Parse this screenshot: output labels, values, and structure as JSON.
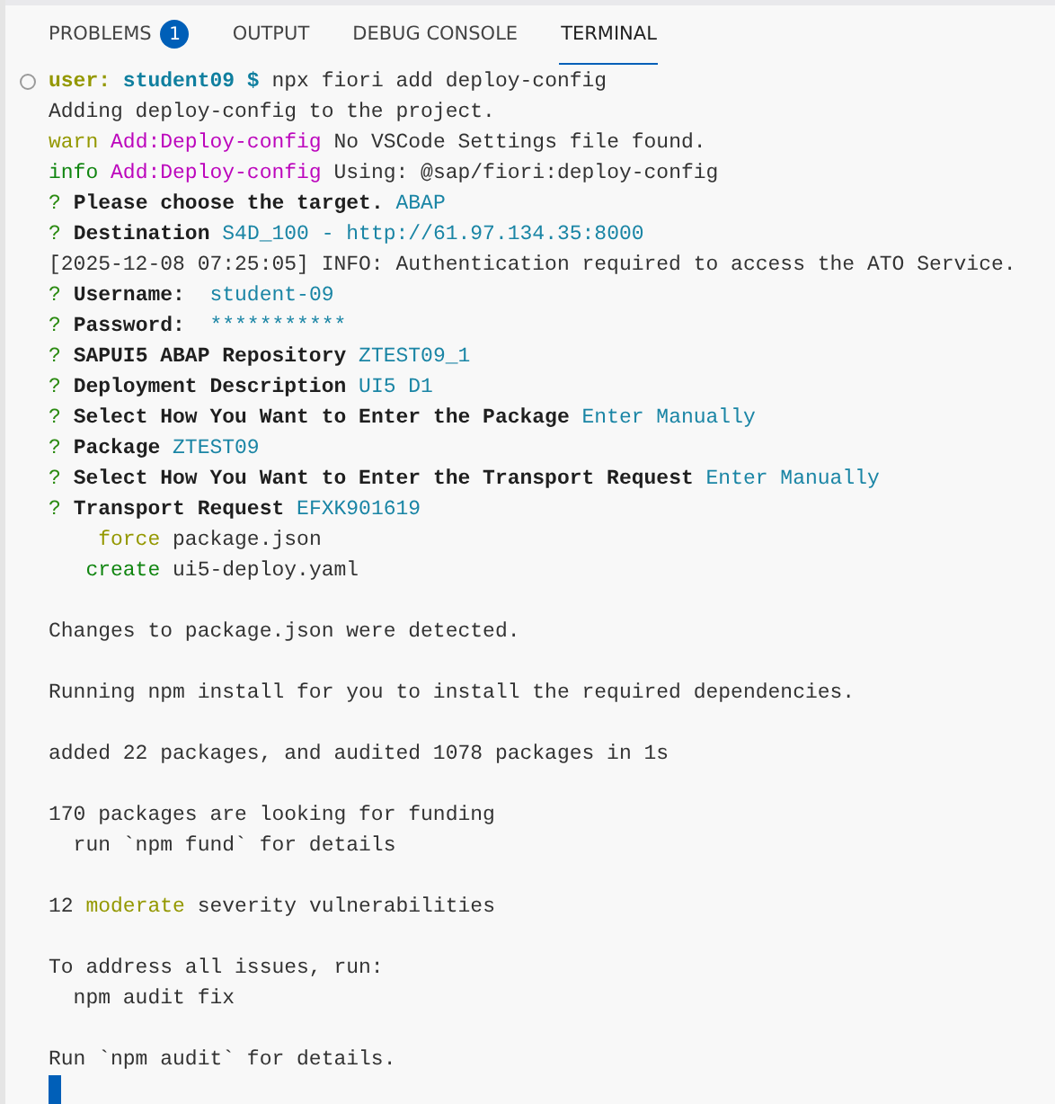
{
  "tabs": [
    {
      "label": "PROBLEMS",
      "badge": "1",
      "selected": false
    },
    {
      "label": "OUTPUT",
      "selected": false
    },
    {
      "label": "DEBUG CONSOLE",
      "selected": false
    },
    {
      "label": "TERMINAL",
      "selected": true
    }
  ],
  "terminal": {
    "lines": [
      {
        "kind": "prompt",
        "segments": [
          {
            "kind": "user",
            "text": "user: "
          },
          {
            "kind": "host",
            "text": "student09 $"
          },
          {
            "kind": "plain",
            "text": " npx fiori add deploy-config"
          }
        ]
      },
      {
        "kind": "output",
        "segments": [
          {
            "kind": "plain",
            "text": "Adding deploy-config to the project."
          }
        ]
      },
      {
        "kind": "output",
        "segments": [
          {
            "kind": "warn",
            "text": "warn "
          },
          {
            "kind": "tag",
            "text": "Add:Deploy-config"
          },
          {
            "kind": "plain",
            "text": " No VSCode Settings file found."
          }
        ]
      },
      {
        "kind": "output",
        "segments": [
          {
            "kind": "ok",
            "text": "info "
          },
          {
            "kind": "tag",
            "text": "Add:Deploy-config"
          },
          {
            "kind": "plain",
            "text": " Using: @sap/fiori:deploy-config"
          }
        ]
      },
      {
        "kind": "output",
        "segments": [
          {
            "kind": "question",
            "text": "? "
          },
          {
            "kind": "bold",
            "text": "Please choose the target."
          },
          {
            "kind": "value",
            "text": " ABAP"
          }
        ]
      },
      {
        "kind": "output",
        "segments": [
          {
            "kind": "question",
            "text": "? "
          },
          {
            "kind": "bold",
            "text": "Destination"
          },
          {
            "kind": "value",
            "text": " S4D_100 - http://61.97.134.35:8000"
          }
        ]
      },
      {
        "kind": "output",
        "segments": [
          {
            "kind": "plain",
            "text": "[2025-12-08 07:25:05] INFO: Authentication required to access the ATO Service."
          }
        ]
      },
      {
        "kind": "output",
        "segments": [
          {
            "kind": "question",
            "text": "? "
          },
          {
            "kind": "bold",
            "text": "Username: "
          },
          {
            "kind": "value",
            "text": " student-09"
          }
        ]
      },
      {
        "kind": "output",
        "segments": [
          {
            "kind": "question",
            "text": "? "
          },
          {
            "kind": "bold",
            "text": "Password: "
          },
          {
            "kind": "value",
            "text": " ***********"
          }
        ]
      },
      {
        "kind": "output",
        "segments": [
          {
            "kind": "question",
            "text": "? "
          },
          {
            "kind": "bold",
            "text": "SAPUI5 ABAP Repository"
          },
          {
            "kind": "value",
            "text": " ZTEST09_1"
          }
        ]
      },
      {
        "kind": "output",
        "segments": [
          {
            "kind": "question",
            "text": "? "
          },
          {
            "kind": "bold",
            "text": "Deployment Description"
          },
          {
            "kind": "value",
            "text": " UI5 D1"
          }
        ]
      },
      {
        "kind": "output",
        "segments": [
          {
            "kind": "question",
            "text": "? "
          },
          {
            "kind": "bold",
            "text": "Select How You Want to Enter the Package"
          },
          {
            "kind": "value",
            "text": " Enter Manually"
          }
        ]
      },
      {
        "kind": "output",
        "segments": [
          {
            "kind": "question",
            "text": "? "
          },
          {
            "kind": "bold",
            "text": "Package"
          },
          {
            "kind": "value",
            "text": " ZTEST09"
          }
        ]
      },
      {
        "kind": "output",
        "segments": [
          {
            "kind": "question",
            "text": "? "
          },
          {
            "kind": "bold",
            "text": "Select How You Want to Enter the Transport Request"
          },
          {
            "kind": "value",
            "text": " Enter Manually"
          }
        ]
      },
      {
        "kind": "output",
        "segments": [
          {
            "kind": "question",
            "text": "? "
          },
          {
            "kind": "bold",
            "text": "Transport Request"
          },
          {
            "kind": "value",
            "text": " EFXK901619"
          }
        ]
      },
      {
        "kind": "output",
        "segments": [
          {
            "kind": "warn",
            "text": "    force"
          },
          {
            "kind": "plain",
            "text": " package.json"
          }
        ]
      },
      {
        "kind": "output",
        "segments": [
          {
            "kind": "ok",
            "text": "   create"
          },
          {
            "kind": "plain",
            "text": " ui5-deploy.yaml"
          }
        ]
      },
      {
        "kind": "blank"
      },
      {
        "kind": "output",
        "segments": [
          {
            "kind": "plain",
            "text": "Changes to package.json were detected."
          }
        ]
      },
      {
        "kind": "blank"
      },
      {
        "kind": "output",
        "segments": [
          {
            "kind": "plain",
            "text": "Running npm install for you to install the required dependencies."
          }
        ]
      },
      {
        "kind": "blank"
      },
      {
        "kind": "output",
        "segments": [
          {
            "kind": "plain",
            "text": "added 22 packages, and audited 1078 packages in 1s"
          }
        ]
      },
      {
        "kind": "blank"
      },
      {
        "kind": "output",
        "segments": [
          {
            "kind": "plain",
            "text": "170 packages are looking for funding"
          }
        ]
      },
      {
        "kind": "output",
        "segments": [
          {
            "kind": "plain",
            "text": "  run `npm fund` for details"
          }
        ]
      },
      {
        "kind": "blank"
      },
      {
        "kind": "output",
        "segments": [
          {
            "kind": "plain",
            "text": "12 "
          },
          {
            "kind": "warn",
            "text": "moderate"
          },
          {
            "kind": "plain",
            "text": " severity vulnerabilities"
          }
        ]
      },
      {
        "kind": "blank"
      },
      {
        "kind": "output",
        "segments": [
          {
            "kind": "plain",
            "text": "To address all issues, run:"
          }
        ]
      },
      {
        "kind": "output",
        "segments": [
          {
            "kind": "plain",
            "text": "  npm audit fix"
          }
        ]
      },
      {
        "kind": "blank"
      },
      {
        "kind": "output",
        "segments": [
          {
            "kind": "plain",
            "text": "Run `npm audit` for details."
          }
        ]
      },
      {
        "kind": "cursor"
      }
    ]
  }
}
